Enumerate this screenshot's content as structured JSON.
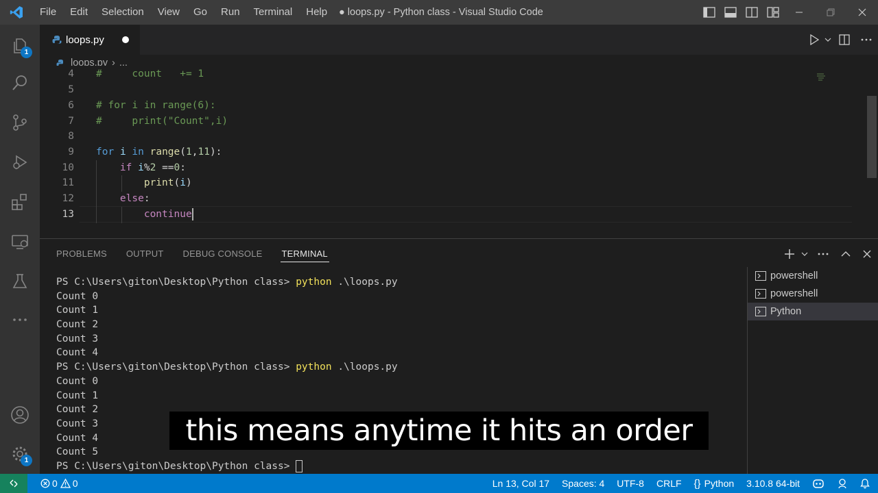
{
  "titlebar": {
    "menu": [
      "File",
      "Edit",
      "Selection",
      "View",
      "Go",
      "Run",
      "Terminal",
      "Help"
    ],
    "window_title": "● loops.py - Python class - Visual Studio Code"
  },
  "activity": {
    "explorer_badge": "1",
    "settings_badge": "1"
  },
  "editor": {
    "tab_label": "loops.py",
    "breadcrumb_file": "loops.py",
    "breadcrumb_more": "...",
    "lines": [
      {
        "n": "4",
        "text": "#     count   += 1"
      },
      {
        "n": "5",
        "text": ""
      },
      {
        "n": "6",
        "text": "# for i in range(6):"
      },
      {
        "n": "7",
        "text": "#     print(\"Count\",i)"
      },
      {
        "n": "8",
        "text": ""
      },
      {
        "n": "9",
        "text": "for i in range(1,11):"
      },
      {
        "n": "10",
        "text": "    if i%2 ==0:"
      },
      {
        "n": "11",
        "text": "        print(i)"
      },
      {
        "n": "12",
        "text": "    else:"
      },
      {
        "n": "13",
        "text": "        continue"
      }
    ]
  },
  "panel": {
    "tabs": [
      "PROBLEMS",
      "OUTPUT",
      "DEBUG CONSOLE",
      "TERMINAL"
    ],
    "active_tab": "TERMINAL",
    "prompt": "PS C:\\Users\\giton\\Desktop\\Python class> ",
    "command": "python",
    "command_arg": " .\\loops.py",
    "output1": [
      "Count 0",
      "Count 1",
      "Count 2",
      "Count 3",
      "Count 4"
    ],
    "output2": [
      "Count 0",
      "Count 1",
      "Count 2",
      "Count 3",
      "Count 4",
      "Count 5"
    ],
    "terminals": [
      "powershell",
      "powershell",
      "Python"
    ]
  },
  "statusbar": {
    "errors": "0",
    "warnings": "0",
    "position": "Ln 13, Col 17",
    "spaces": "Spaces: 4",
    "encoding": "UTF-8",
    "eol": "CRLF",
    "language": "Python",
    "interpreter": "3.10.8 64-bit"
  },
  "caption": "this means anytime it hits an order",
  "colors": {
    "accent": "#007acc",
    "remote": "#16825d",
    "badge": "#0e76c4"
  }
}
